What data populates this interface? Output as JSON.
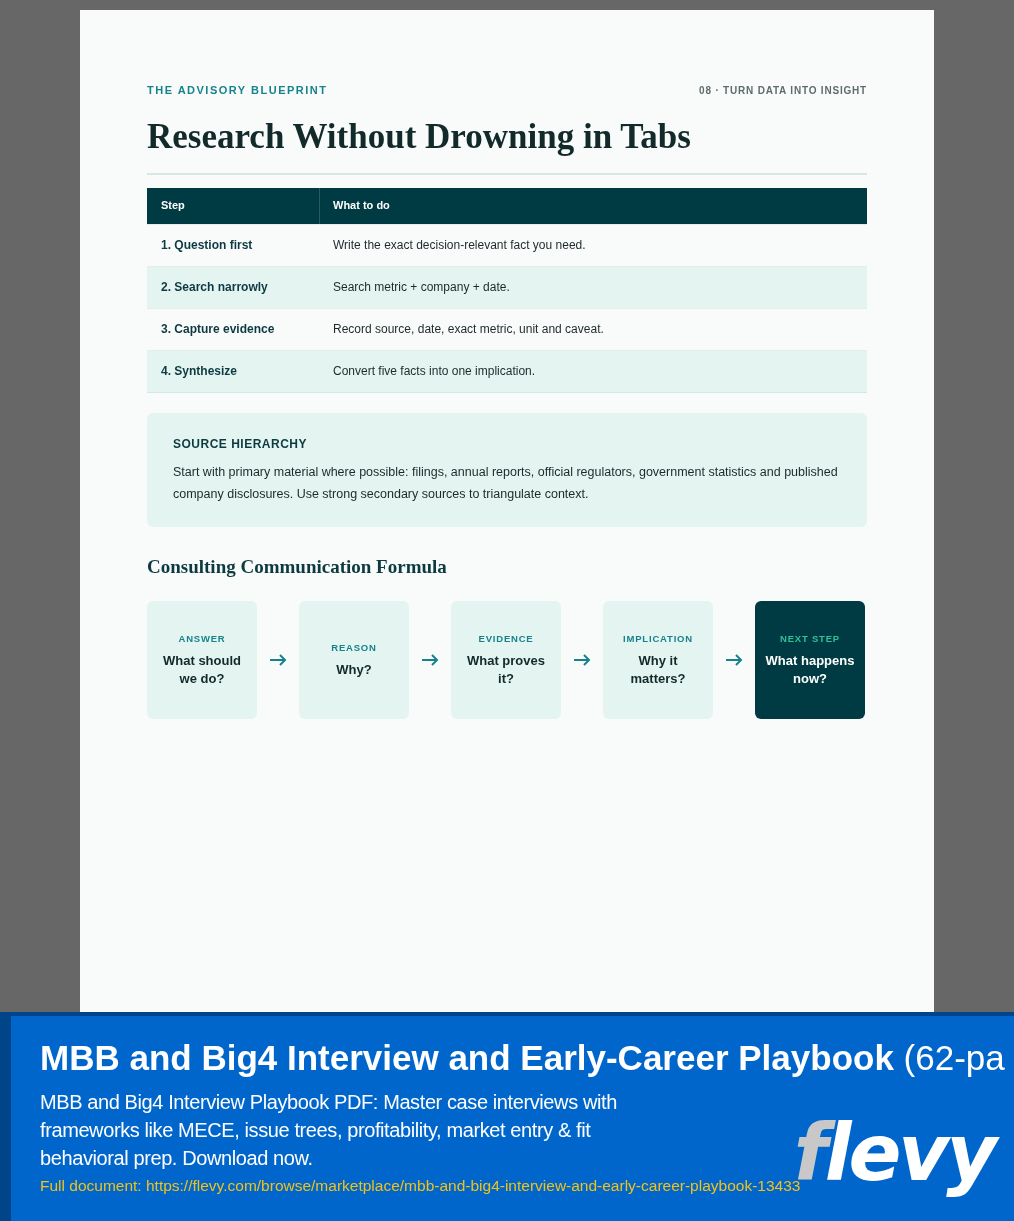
{
  "page": {
    "kicker": "THE ADVISORY BLUEPRINT",
    "section": "08 · TURN DATA INTO INSIGHT",
    "title": "Research Without Drowning in Tabs"
  },
  "table": {
    "columns": [
      "Step",
      "What to do"
    ],
    "rows": [
      {
        "step": "1. Question first",
        "action": "Write the exact decision-relevant fact you need."
      },
      {
        "step": "2. Search narrowly",
        "action": "Search metric + company + date."
      },
      {
        "step": "3. Capture evidence",
        "action": "Record source, date, exact metric, unit and caveat."
      },
      {
        "step": "4. Synthesize",
        "action": "Convert five facts into one implication."
      }
    ]
  },
  "callout": {
    "heading": "SOURCE HIERARCHY",
    "body": "Start with primary material where possible: filings, annual reports, official regulators, government statistics and published company disclosures. Use strong secondary sources to triangulate context."
  },
  "formula": {
    "heading": "Consulting Communication Formula",
    "steps": [
      {
        "label": "ANSWER",
        "question": "What should we do?",
        "highlighted": false
      },
      {
        "label": "REASON",
        "question": "Why?",
        "highlighted": false
      },
      {
        "label": "EVIDENCE",
        "question": "What proves it?",
        "highlighted": false
      },
      {
        "label": "IMPLICATION",
        "question": "Why it matters?",
        "highlighted": false
      },
      {
        "label": "NEXT STEP",
        "question": "What happens now?",
        "highlighted": true
      }
    ]
  },
  "banner": {
    "title": "MBB and Big4 Interview and Early-Career Playbook",
    "title_suffix": "(62-pa",
    "description": "MBB and Big4 Interview Playbook PDF: Master case interviews with frameworks like MECE, issue trees, profitability, market entry & fit behavioral prep. Download now.",
    "link": "Full document: https://flevy.com/browse/marketplace/mbb-and-big4-interview-and-early-career-playbook-13433",
    "logo": [
      "f",
      "levy"
    ]
  }
}
